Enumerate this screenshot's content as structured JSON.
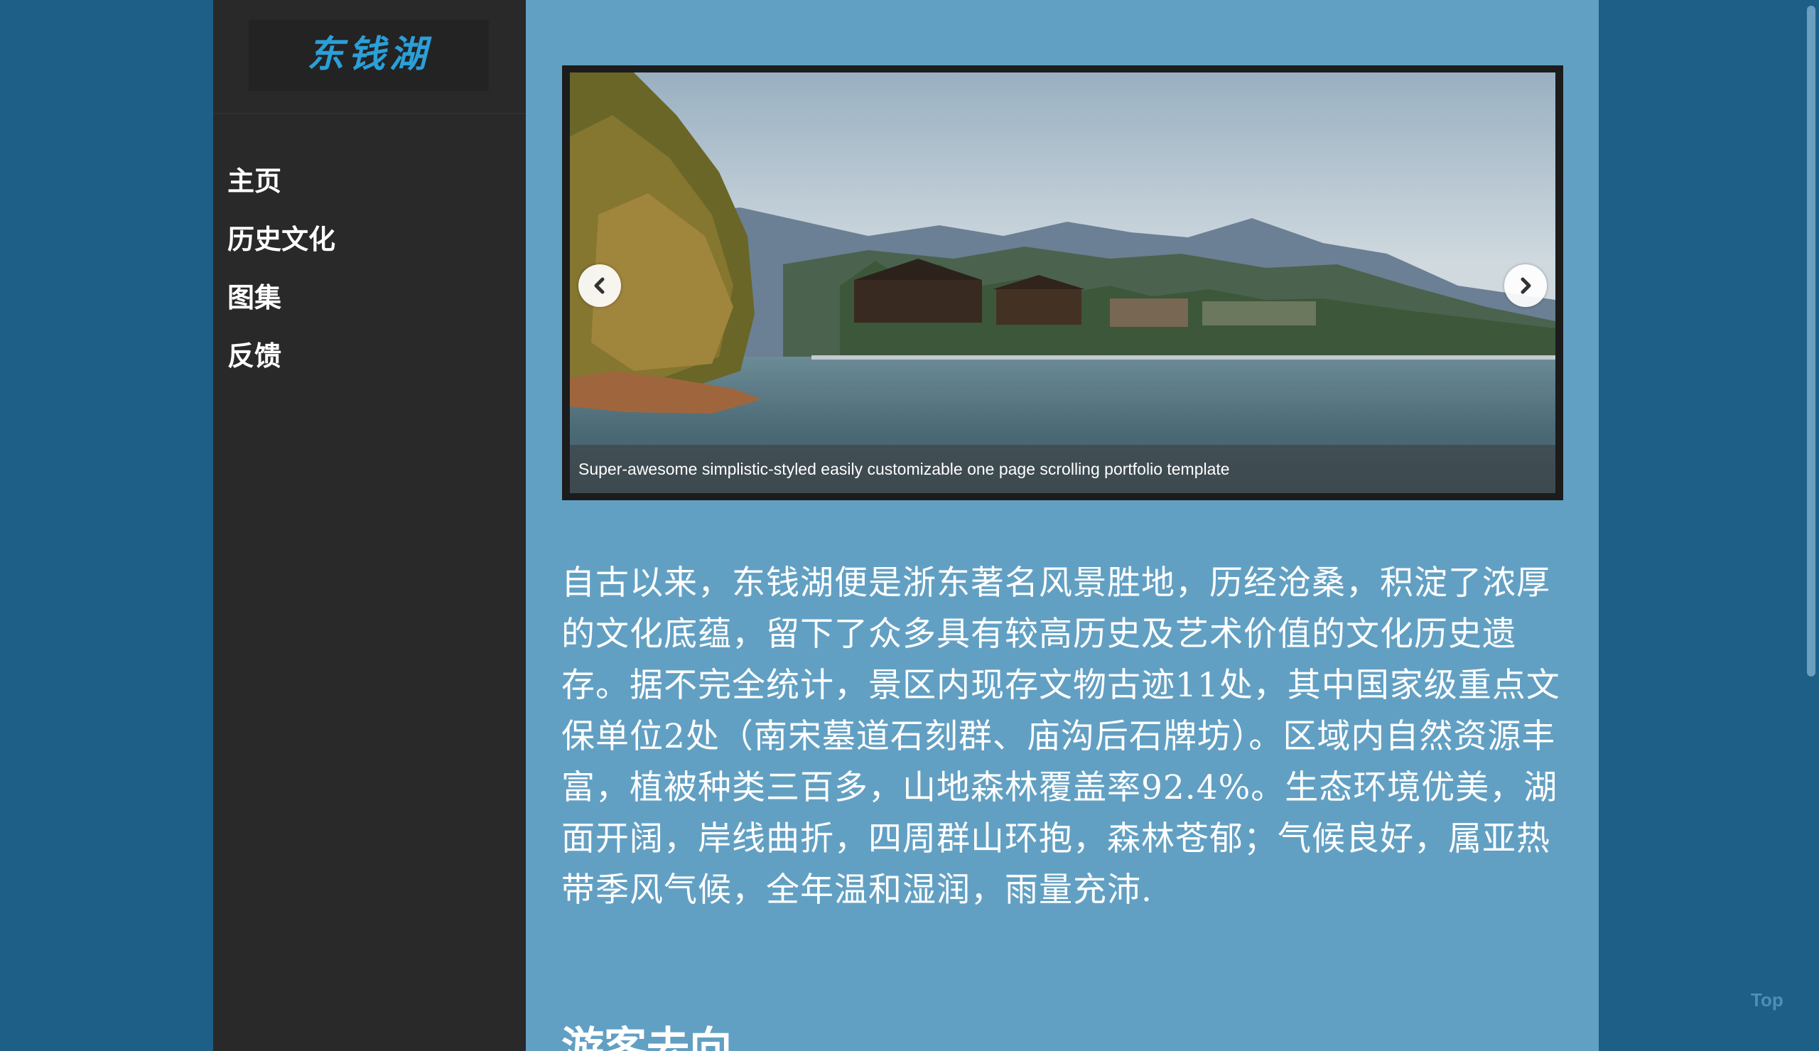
{
  "site": {
    "logo_text": "东钱湖"
  },
  "nav": {
    "items": [
      {
        "label": "主页"
      },
      {
        "label": "历史文化"
      },
      {
        "label": "图集"
      },
      {
        "label": "反馈"
      }
    ]
  },
  "slider": {
    "caption": "Super-awesome simplistic-styled easily customizable one page scrolling portfolio template",
    "prev_icon": "chevron-left-icon",
    "next_icon": "chevron-right-icon"
  },
  "content": {
    "intro": "自古以来，东钱湖便是浙东著名风景胜地，历经沧桑，积淀了浓厚的文化底蕴，留下了众多具有较高历史及艺术价值的文化历史遗存。据不完全统计，景区内现存文物古迹11处，其中国家级重点文保单位2处（南宋墓道石刻群、庙沟后石牌坊）。区域内自然资源丰富，植被种类三百多，山地森林覆盖率92.4%。生态环境优美，湖面开阔，岸线曲折，四周群山环抱，森林苍郁；气候良好，属亚热带季风气候，全年温和湿润，雨量充沛.",
    "section_heading": "游客去向"
  },
  "back_to_top": "Top",
  "colors": {
    "page_bg": "#1d5f86",
    "sidebar_bg": "#292929",
    "main_bg": "#62a0c3",
    "logo": "#2b9fd8"
  }
}
